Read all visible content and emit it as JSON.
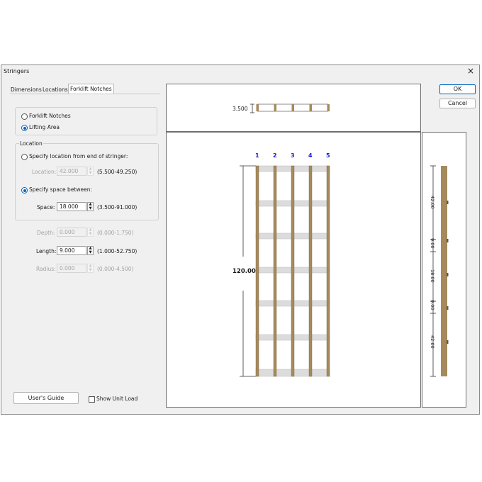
{
  "window": {
    "title": "Stringers",
    "close_glyph": "×"
  },
  "tabs": [
    {
      "label": "Dimensions"
    },
    {
      "label": "Locations"
    },
    {
      "label": "Forklift Notches"
    }
  ],
  "notch_type": {
    "forklift_notches": "Forklift Notches",
    "lifting_area": "Lifting Area",
    "selected": "Lifting Area"
  },
  "location": {
    "group_label": "Location",
    "from_end_label": "Specify location from end of stringer:",
    "location_label": "Location:",
    "location_value": "42.000",
    "location_range": "(5.500-49.250)",
    "space_between_label": "Specify space between:",
    "space_label": "Space:",
    "space_value": "18.000",
    "space_range": "(3.500-91.000)",
    "selected": "Specify space between:"
  },
  "dims": {
    "depth_label": "Depth:",
    "depth_value": "0.000",
    "depth_range": "(0.000-1.750)",
    "length_label": "Length:",
    "length_value": "9.000",
    "length_range": "(1.000-52.750)",
    "radius_label": "Radius:",
    "radius_value": "0.000",
    "radius_range": "(0.000-4.500)"
  },
  "buttons": {
    "ok": "OK",
    "cancel": "Cancel",
    "users_guide": "User's Guide",
    "show_unit_load": "Show Unit Load"
  },
  "preview": {
    "end_view_dim": "3.500",
    "stringer_numbers": [
      "1",
      "2",
      "3",
      "4",
      "5"
    ],
    "length_dim": "120.00",
    "side_dims": [
      "42.00",
      "9.00",
      "18.00",
      "9.00",
      "42.00"
    ],
    "wood_color": "#a58a5c",
    "board_color": "#dcdcdc",
    "number_color": "#1a1acc"
  }
}
